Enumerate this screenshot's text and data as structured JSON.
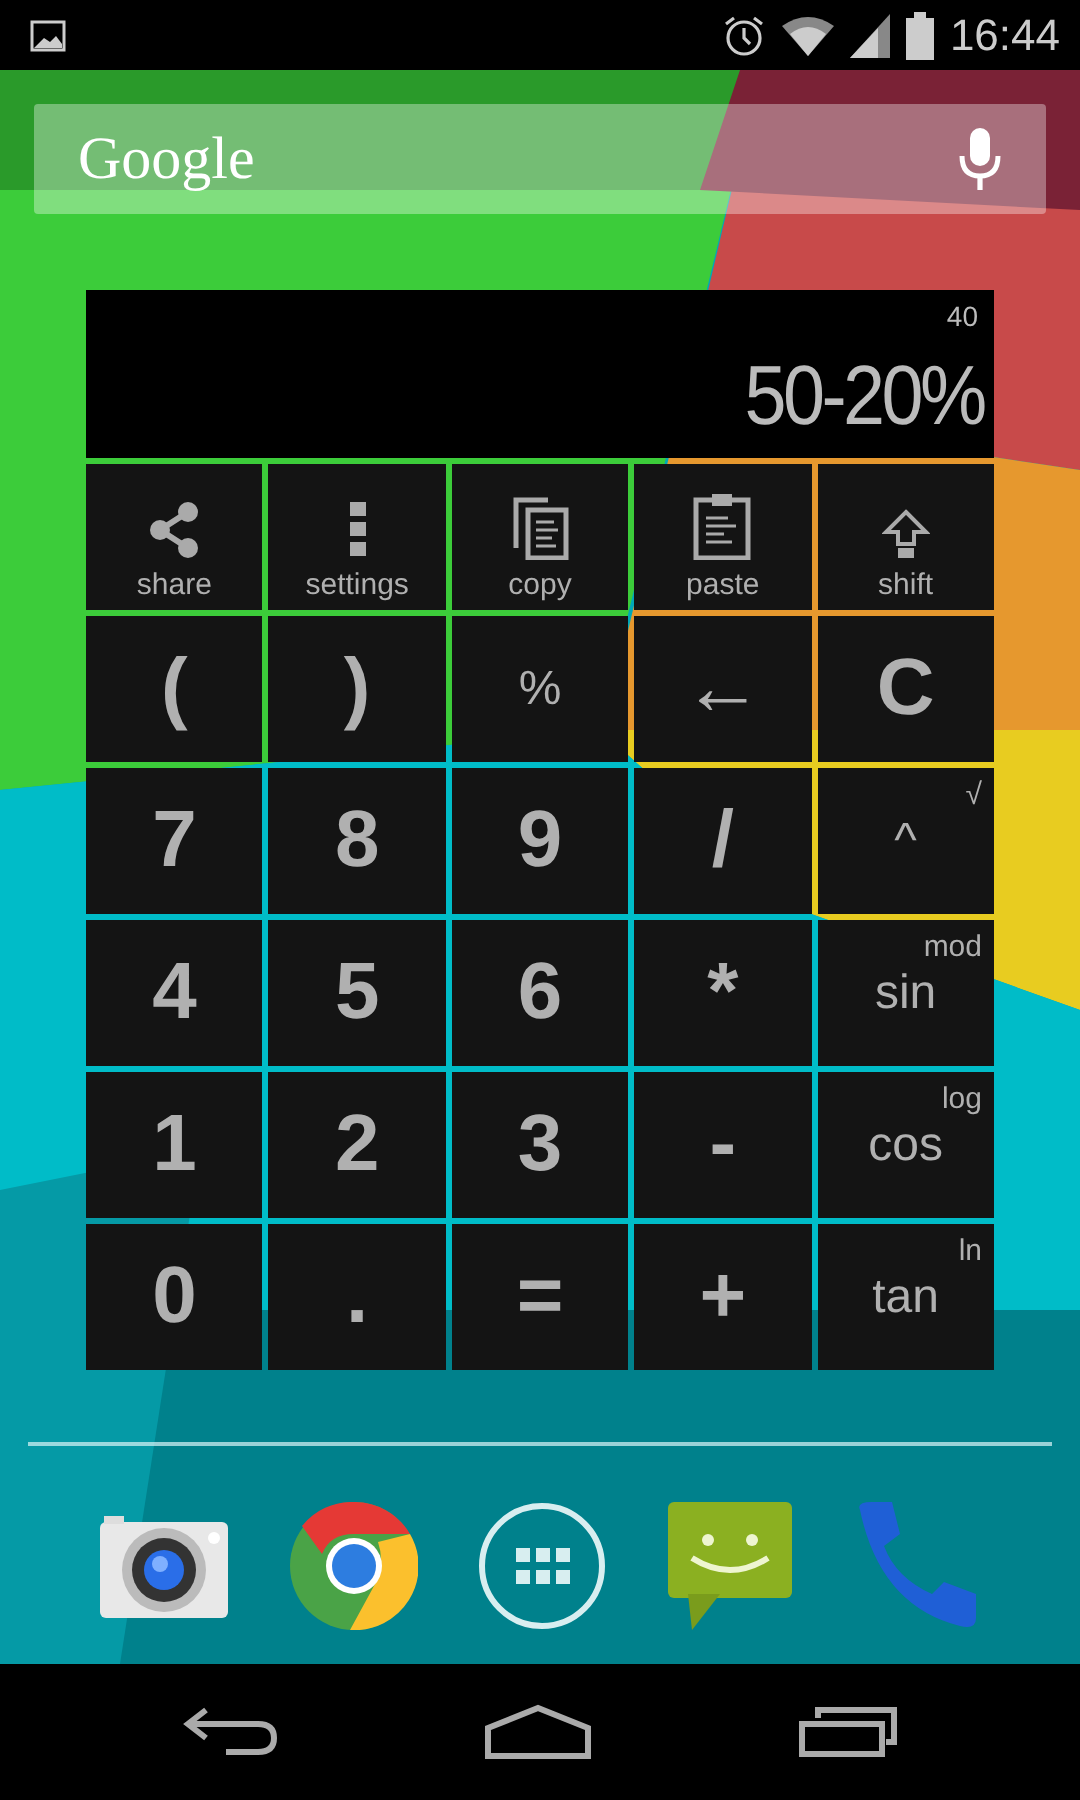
{
  "status_bar": {
    "time": "16:44"
  },
  "search": {
    "label": "Google"
  },
  "calculator": {
    "result": "40",
    "expression": "50-20%",
    "keys": [
      {
        "label": "share",
        "kind": "tool"
      },
      {
        "label": "settings",
        "kind": "tool"
      },
      {
        "label": "copy",
        "kind": "tool"
      },
      {
        "label": "paste",
        "kind": "tool"
      },
      {
        "label": "shift",
        "kind": "tool"
      },
      {
        "label": "(",
        "kind": "symbol"
      },
      {
        "label": ")",
        "kind": "symbol"
      },
      {
        "label": "%",
        "kind": "word"
      },
      {
        "label": "←",
        "kind": "symbol"
      },
      {
        "label": "C",
        "kind": "symbol"
      },
      {
        "label": "7",
        "kind": "symbol"
      },
      {
        "label": "8",
        "kind": "symbol"
      },
      {
        "label": "9",
        "kind": "symbol"
      },
      {
        "label": "/",
        "kind": "symbol"
      },
      {
        "label": "^",
        "kind": "word",
        "superscript": "√"
      },
      {
        "label": "4",
        "kind": "symbol"
      },
      {
        "label": "5",
        "kind": "symbol"
      },
      {
        "label": "6",
        "kind": "symbol"
      },
      {
        "label": "*",
        "kind": "symbol"
      },
      {
        "label": "sin",
        "kind": "word",
        "superscript": "mod"
      },
      {
        "label": "1",
        "kind": "symbol"
      },
      {
        "label": "2",
        "kind": "symbol"
      },
      {
        "label": "3",
        "kind": "symbol"
      },
      {
        "label": "-",
        "kind": "symbol"
      },
      {
        "label": "cos",
        "kind": "word",
        "superscript": "log"
      },
      {
        "label": "0",
        "kind": "symbol"
      },
      {
        "label": ".",
        "kind": "symbol"
      },
      {
        "label": "=",
        "kind": "symbol"
      },
      {
        "label": "+",
        "kind": "symbol"
      },
      {
        "label": "tan",
        "kind": "word",
        "superscript": "ln"
      }
    ]
  }
}
